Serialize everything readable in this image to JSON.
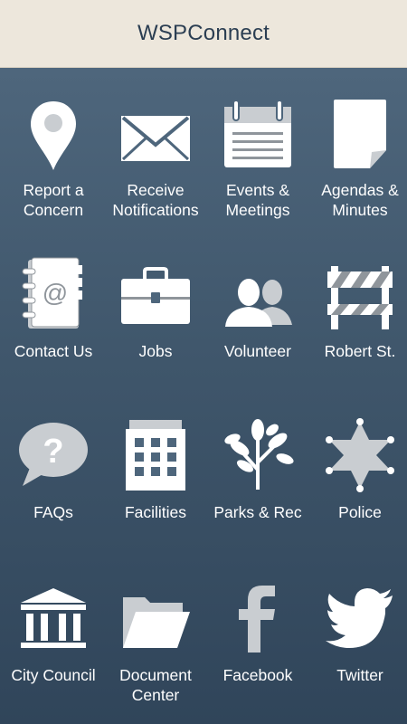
{
  "header": {
    "title": "WSPConnect"
  },
  "tiles": [
    {
      "label": "Report a\nConcern",
      "icon": "map-pin-icon"
    },
    {
      "label": "Receive\nNotifications",
      "icon": "envelope-icon"
    },
    {
      "label": "Events &\nMeetings",
      "icon": "calendar-icon"
    },
    {
      "label": "Agendas &\nMinutes",
      "icon": "document-page-icon"
    },
    {
      "label": "Contact Us",
      "icon": "address-book-icon"
    },
    {
      "label": "Jobs",
      "icon": "briefcase-icon"
    },
    {
      "label": "Volunteer",
      "icon": "people-icon"
    },
    {
      "label": "Robert St.",
      "icon": "road-barrier-icon"
    },
    {
      "label": "FAQs",
      "icon": "question-bubble-icon"
    },
    {
      "label": "Facilities",
      "icon": "building-icon"
    },
    {
      "label": "Parks & Rec",
      "icon": "tree-icon"
    },
    {
      "label": "Police",
      "icon": "police-star-icon"
    },
    {
      "label": "City Council",
      "icon": "city-hall-icon"
    },
    {
      "label": "Document\nCenter",
      "icon": "folder-icon"
    },
    {
      "label": "Facebook",
      "icon": "facebook-icon"
    },
    {
      "label": "Twitter",
      "icon": "twitter-bird-icon"
    }
  ],
  "colors": {
    "header_bg": "#ede7dc",
    "title_text": "#2b3e52",
    "icon_fill": "#ffffff",
    "icon_shade": "#c9cdd1",
    "icon_dark": "#8f959b"
  }
}
